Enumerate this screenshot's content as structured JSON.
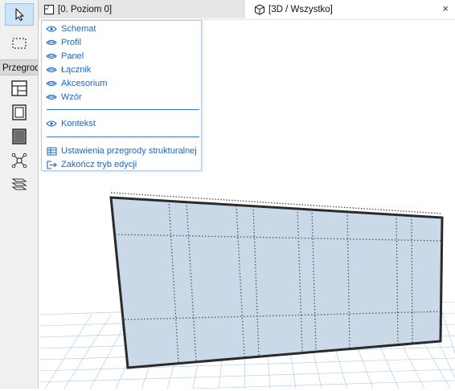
{
  "toolbox": {
    "section_label": "Przegroda",
    "tools": [
      {
        "name": "arrow-tool",
        "icon": "arrow-pointer-icon"
      },
      {
        "name": "marquee-tool",
        "icon": "marquee-icon"
      },
      {
        "name": "schematic-tool",
        "icon": "curtain-wall-scheme-icon"
      },
      {
        "name": "frame-tool",
        "icon": "curtain-wall-frame-icon"
      },
      {
        "name": "panel-tool",
        "icon": "curtain-wall-panel-icon"
      },
      {
        "name": "junction-tool",
        "icon": "curtain-wall-junction-icon"
      },
      {
        "name": "accessory-tool",
        "icon": "curtain-wall-accessory-icon"
      }
    ]
  },
  "tabs": {
    "plan": "[0. Poziom 0]",
    "view3d": "[3D / Wszystko]",
    "close": "×"
  },
  "menu": {
    "items": [
      {
        "label": "Schemat",
        "icon": "eye-icon"
      },
      {
        "label": "Profil",
        "icon": "eye-closed-icon"
      },
      {
        "label": "Panel",
        "icon": "eye-closed-icon"
      },
      {
        "label": "Łącznik",
        "icon": "eye-closed-icon"
      },
      {
        "label": "Akcesorium",
        "icon": "eye-closed-icon"
      },
      {
        "label": "Wzór",
        "icon": "eye-closed-icon"
      }
    ],
    "context": {
      "label": "Kontekst",
      "icon": "eye-icon"
    },
    "settings": {
      "label": "Ustawienia przegrody strukturalnej",
      "icon": "settings-grid-icon"
    },
    "exit": {
      "label": "Zakończ tryb edycji",
      "icon": "exit-icon"
    }
  },
  "colors": {
    "accent": "#1b66c9",
    "wall_fill": "#c9d9e8",
    "grid": "#a9c6ea"
  }
}
